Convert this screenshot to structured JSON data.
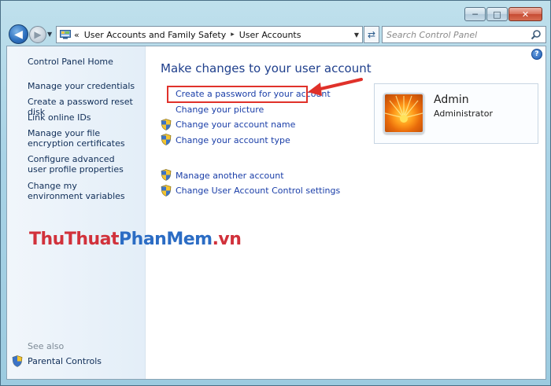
{
  "window": {
    "minimize_glyph": "─",
    "maximize_glyph": "□",
    "close_glyph": "✕"
  },
  "address_bar": {
    "overflow_glyph": "«",
    "crumbs": [
      "User Accounts and Family Safety",
      "User Accounts"
    ],
    "separator": "▸"
  },
  "search": {
    "placeholder": "Search Control Panel"
  },
  "sidebar": {
    "home": "Control Panel Home",
    "links": [
      "Manage your credentials",
      "Create a password reset disk",
      "Link online IDs",
      "Manage your file encryption certificates",
      "Configure advanced user profile properties",
      "Change my environment variables"
    ],
    "see_also_label": "See also",
    "parental_controls": "Parental Controls"
  },
  "main": {
    "title": "Make changes to your user account",
    "tasks": [
      "Create a password for your account",
      "Change your picture",
      "Change your account name",
      "Change your account type",
      "Manage another account",
      "Change User Account Control settings"
    ]
  },
  "user": {
    "name": "Admin",
    "role": "Administrator"
  },
  "watermark": {
    "part1": "ThuThuat",
    "part2": "PhanMem",
    "part3": ".vn"
  },
  "colors": {
    "link": "#1a3ea8",
    "highlight": "#e0312a",
    "title": "#1f3f8c"
  }
}
